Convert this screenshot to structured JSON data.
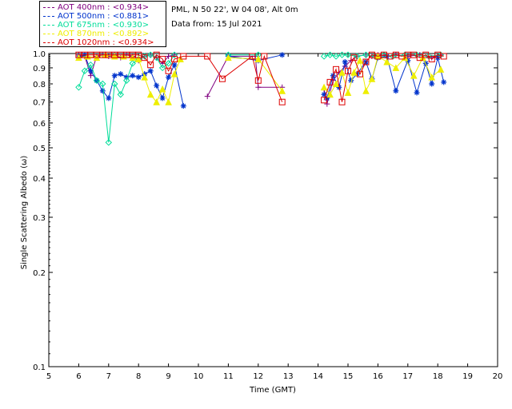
{
  "header": {
    "site": "PML, N 50 22', W 04 08', Alt 0m",
    "date": "Data from: 15 Jul 2021"
  },
  "legend": [
    {
      "label": "AOT  400nm : <0.934>",
      "color": "#800080"
    },
    {
      "label": "AOT  500nm : <0.881>",
      "color": "#0033cc"
    },
    {
      "label": "AOT  675nm : <0.930>",
      "color": "#00dd99"
    },
    {
      "label": "AOT  870nm : <0.892>",
      "color": "#eeee00"
    },
    {
      "label": "AOT 1020nm : <0.934>",
      "color": "#dd0000"
    }
  ],
  "chart_data": {
    "type": "scatter",
    "xlabel": "Time (GMT)",
    "ylabel": "Single Scattering Albedo (ω)",
    "xlim": [
      5,
      20
    ],
    "ylim": [
      0.1,
      1.0
    ],
    "yscale": "log",
    "xticks": [
      5,
      6,
      7,
      8,
      9,
      10,
      11,
      12,
      13,
      14,
      15,
      16,
      17,
      18,
      19,
      20
    ],
    "yticks": [
      0.1,
      0.2,
      0.3,
      0.4,
      0.5,
      0.6,
      0.7,
      0.8,
      0.9,
      1.0
    ],
    "series": [
      {
        "name": "AOT  400nm",
        "color": "#800080",
        "marker": "plus",
        "x": [
          6.0,
          6.2,
          6.4,
          6.6,
          6.8,
          7.0,
          7.2,
          7.4,
          7.6,
          7.8,
          8.0,
          8.2,
          8.4,
          8.6,
          8.8,
          9.0,
          9.2,
          10.3,
          11.0,
          11.9,
          12.0,
          12.8,
          14.2,
          14.3,
          14.5,
          14.7,
          14.9,
          15.1,
          15.3,
          15.6,
          15.8,
          16.0,
          16.3,
          16.6,
          17.0,
          17.4,
          17.8,
          18.1
        ],
        "y": [
          0.99,
          0.98,
          0.85,
          0.98,
          0.99,
          0.98,
          0.99,
          0.97,
          0.99,
          0.98,
          0.95,
          0.98,
          0.99,
          0.97,
          0.93,
          0.98,
          0.99,
          0.73,
          0.98,
          0.98,
          0.78,
          0.78,
          0.77,
          0.69,
          0.82,
          0.87,
          0.91,
          0.95,
          0.98,
          0.99,
          0.98,
          0.99,
          0.98,
          0.99,
          0.98,
          0.99,
          0.97,
          0.99
        ]
      },
      {
        "name": "AOT  500nm",
        "color": "#0033cc",
        "marker": "asterisk",
        "x": [
          6.0,
          6.2,
          6.4,
          6.6,
          6.8,
          7.0,
          7.2,
          7.4,
          7.6,
          7.8,
          8.0,
          8.2,
          8.4,
          8.6,
          8.8,
          9.0,
          9.2,
          9.5,
          11.0,
          12.0,
          12.8,
          14.2,
          14.3,
          14.5,
          14.7,
          14.9,
          15.1,
          15.3,
          15.6,
          15.8,
          16.0,
          16.3,
          16.6,
          17.0,
          17.3,
          17.6,
          17.8,
          18.0,
          18.2
        ],
        "y": [
          0.97,
          0.99,
          0.88,
          0.82,
          0.76,
          0.72,
          0.85,
          0.86,
          0.84,
          0.85,
          0.84,
          0.86,
          0.88,
          0.79,
          0.72,
          0.84,
          0.92,
          0.68,
          0.98,
          0.95,
          0.99,
          0.74,
          0.72,
          0.85,
          0.78,
          0.94,
          0.82,
          0.86,
          0.94,
          0.83,
          0.97,
          0.98,
          0.76,
          0.95,
          0.75,
          0.93,
          0.8,
          0.97,
          0.81
        ]
      },
      {
        "name": "AOT  675nm",
        "color": "#00dd99",
        "marker": "diamond",
        "x": [
          6.0,
          6.2,
          6.4,
          6.6,
          6.8,
          7.0,
          7.2,
          7.4,
          7.6,
          7.8,
          8.0,
          8.2,
          8.4,
          8.6,
          8.8,
          9.0,
          9.2,
          11.0,
          12.0,
          14.2,
          14.4,
          14.6,
          14.8,
          15.0,
          15.3,
          15.6,
          15.9,
          16.2,
          16.5,
          16.9,
          17.3,
          17.7,
          18.1
        ],
        "y": [
          0.78,
          0.88,
          0.92,
          0.82,
          0.8,
          0.52,
          0.8,
          0.74,
          0.82,
          0.93,
          0.96,
          0.98,
          0.99,
          0.97,
          0.9,
          0.93,
          0.99,
          0.99,
          0.99,
          0.98,
          0.99,
          0.98,
          0.99,
          0.99,
          0.98,
          0.99,
          0.98,
          0.99,
          0.98,
          0.99,
          0.99,
          0.98,
          0.99
        ]
      },
      {
        "name": "AOT  870nm",
        "color": "#eeee00",
        "marker": "triangle",
        "x": [
          6.0,
          6.3,
          6.6,
          6.9,
          7.2,
          7.5,
          7.8,
          8.0,
          8.2,
          8.4,
          8.6,
          8.8,
          9.0,
          9.2,
          9.4,
          11.0,
          12.0,
          12.8,
          14.2,
          14.4,
          14.6,
          14.8,
          15.0,
          15.2,
          15.4,
          15.6,
          15.8,
          16.0,
          16.3,
          16.6,
          16.9,
          17.2,
          17.5,
          17.8,
          18.1
        ],
        "y": [
          0.97,
          0.98,
          0.97,
          0.99,
          0.98,
          0.98,
          0.97,
          0.96,
          0.84,
          0.74,
          0.7,
          0.77,
          0.7,
          0.86,
          0.96,
          0.97,
          0.96,
          0.76,
          0.78,
          0.74,
          0.8,
          0.87,
          0.75,
          0.87,
          0.95,
          0.76,
          0.83,
          0.98,
          0.94,
          0.9,
          0.97,
          0.85,
          0.97,
          0.84,
          0.89
        ]
      },
      {
        "name": "AOT 1020nm",
        "color": "#dd0000",
        "marker": "square",
        "x": [
          6.0,
          6.2,
          6.4,
          6.6,
          6.8,
          7.0,
          7.2,
          7.4,
          7.6,
          7.8,
          8.0,
          8.2,
          8.4,
          8.6,
          8.8,
          9.0,
          9.2,
          9.5,
          10.3,
          10.8,
          11.8,
          12.0,
          12.2,
          12.8,
          14.2,
          14.4,
          14.6,
          14.8,
          15.0,
          15.2,
          15.4,
          15.6,
          15.8,
          16.0,
          16.2,
          16.4,
          16.6,
          16.8,
          17.0,
          17.2,
          17.4,
          17.6,
          17.8,
          18.0,
          18.2
        ],
        "y": [
          0.99,
          0.99,
          0.99,
          0.99,
          0.99,
          0.99,
          0.99,
          0.99,
          0.99,
          0.99,
          0.99,
          0.97,
          0.92,
          0.99,
          0.96,
          0.88,
          0.96,
          0.98,
          0.98,
          0.83,
          0.98,
          0.82,
          0.98,
          0.7,
          0.71,
          0.81,
          0.89,
          0.7,
          0.88,
          0.97,
          0.86,
          0.94,
          0.99,
          0.98,
          0.99,
          0.98,
          0.99,
          0.98,
          0.99,
          0.99,
          0.97,
          0.99,
          0.96,
          0.99,
          0.98
        ]
      }
    ]
  }
}
